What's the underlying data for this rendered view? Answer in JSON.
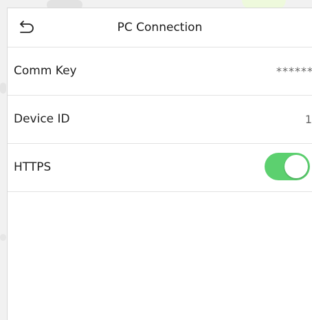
{
  "header": {
    "title": "PC Connection",
    "back_icon": "back-arrow-icon"
  },
  "settings": [
    {
      "label": "Comm Key",
      "value": "******"
    },
    {
      "label": "Device ID",
      "value": "1"
    },
    {
      "label": "HTTPS",
      "toggle_on": true
    }
  ],
  "colors": {
    "toggle_on": "#5cd06f",
    "background": "#ffffff",
    "divider": "#e2e2e2"
  }
}
